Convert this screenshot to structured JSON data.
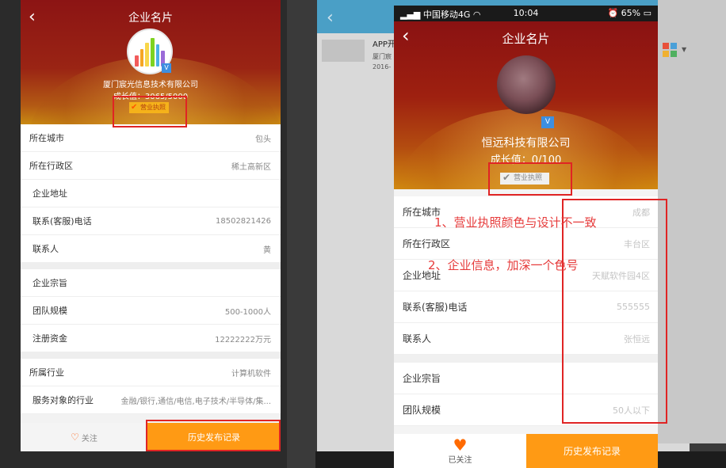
{
  "left_phone": {
    "title": "企业名片",
    "company": "厦门宸光信息技术有限公司",
    "growth": "成长值：3065/5000",
    "license": "营业执照",
    "rows": [
      {
        "label": "所在城市",
        "value": "包头"
      },
      {
        "label": "所在行政区",
        "value": "稀土高新区"
      },
      {
        "label": "企业地址",
        "value": ""
      },
      {
        "label": "联系(客服)电话",
        "value": "18502821426"
      },
      {
        "label": "联系人",
        "value": "黄"
      }
    ],
    "rows2": [
      {
        "label": "企业宗旨",
        "value": ""
      },
      {
        "label": "团队规模",
        "value": "500-1000人"
      },
      {
        "label": "注册资金",
        "value": "12222222万元"
      }
    ],
    "rows3": [
      {
        "label": "所属行业",
        "value": "计算机软件"
      },
      {
        "label": "服务对象的行业",
        "value": "金融/银行,通信/电信,电子技术/半导体/集..."
      }
    ],
    "follow_label": "关注",
    "history_label": "历史发布记录"
  },
  "middle": {
    "app_title": "APP开",
    "sub1": "厦门宸",
    "sub2": "2016-"
  },
  "right_phone": {
    "status": {
      "carrier": "中国移动4G",
      "time": "10:04",
      "battery": "65%"
    },
    "title": "企业名片",
    "company": "恒远科技有限公司",
    "growth": "成长值：0/100",
    "license": "营业执照",
    "rows": [
      {
        "label": "所在城市",
        "value": "成都"
      },
      {
        "label": "所在行政区",
        "value": "丰台区"
      },
      {
        "label": "企业地址",
        "value": "天赋软件园4区"
      },
      {
        "label": "联系(客服)电话",
        "value": "555555"
      },
      {
        "label": "联系人",
        "value": "张恒远"
      }
    ],
    "rows2": [
      {
        "label": "企业宗旨",
        "value": ""
      },
      {
        "label": "团队规模",
        "value": "50人以下"
      }
    ],
    "follow_label": "已关注",
    "history_label": "历史发布记录"
  },
  "annotations": {
    "note1": "1、营业执照颜色与设计不一致",
    "note2": "2、企业信息，加深一个色号"
  },
  "colors": {
    "header_red": "#8c1414",
    "accent_orange": "#ff9a14",
    "annotation_red": "#e63a3a",
    "verified_blue": "#3d8fe0"
  }
}
